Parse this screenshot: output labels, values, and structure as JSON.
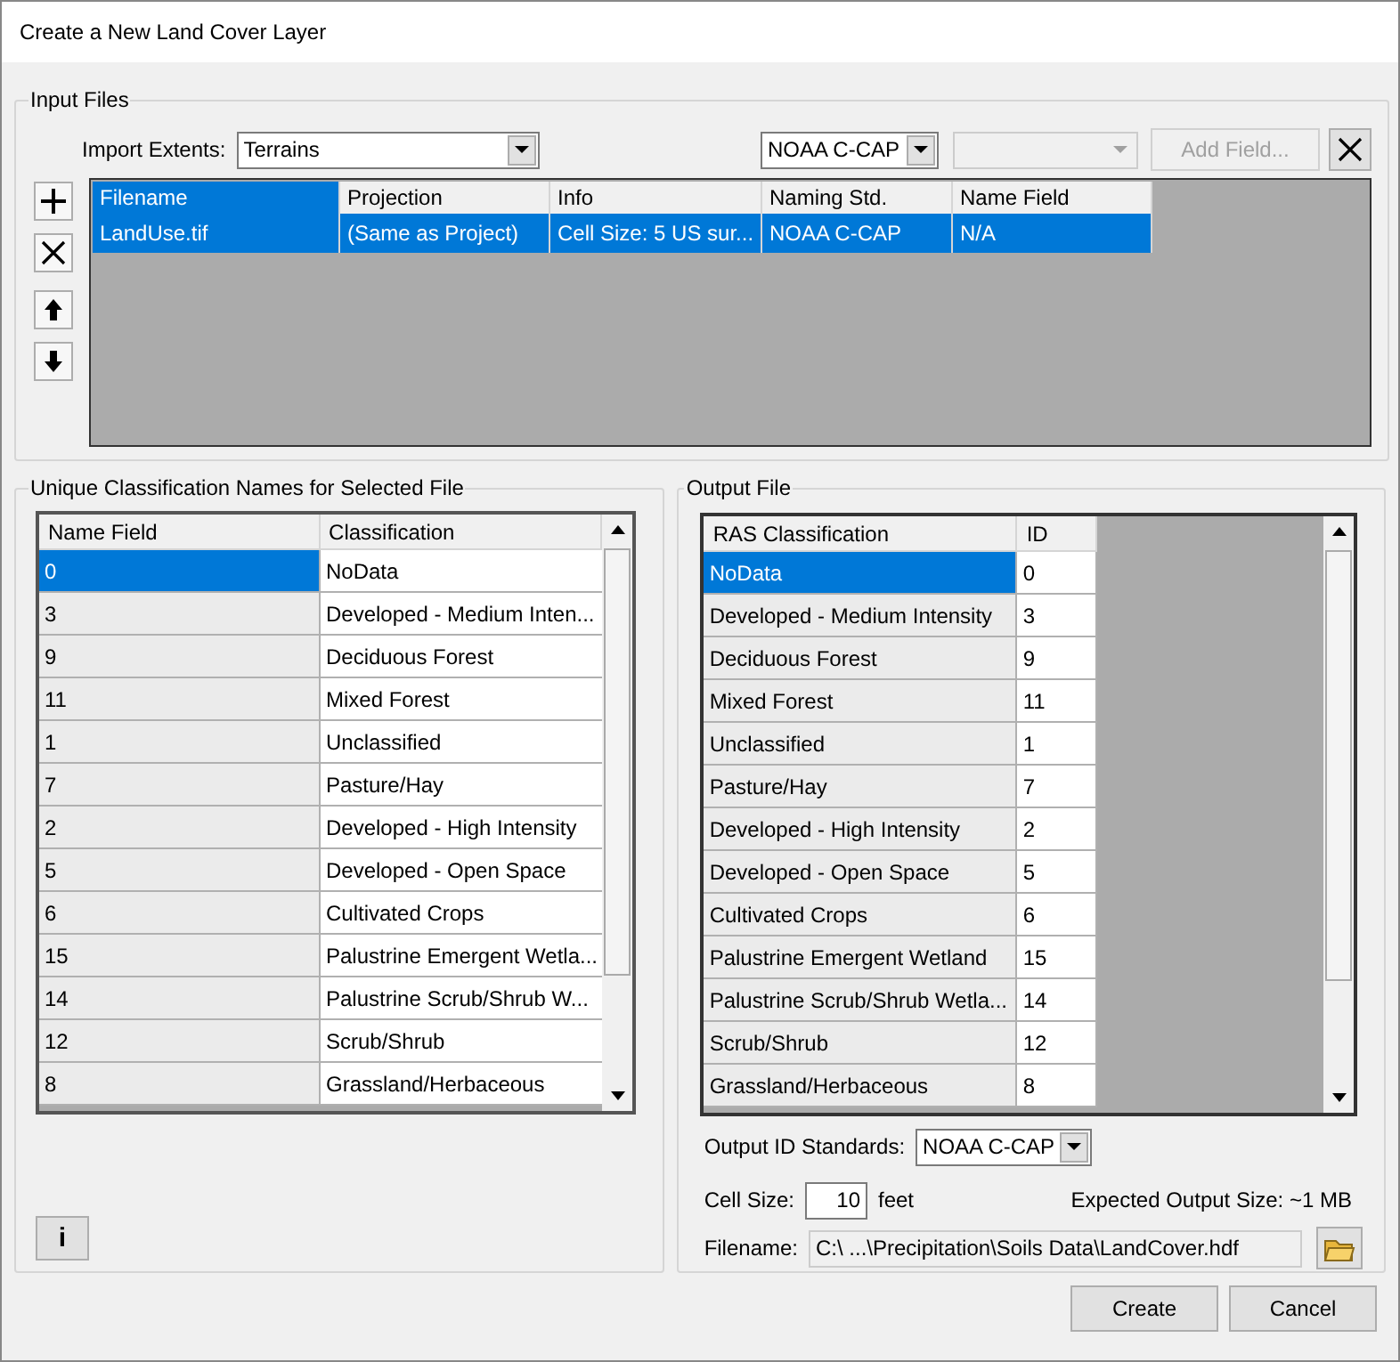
{
  "window": {
    "title": "Create a New Land Cover Layer"
  },
  "input_files": {
    "title": "Input Files",
    "import_extents_label": "Import Extents:",
    "import_extents_value": "Terrains",
    "naming_dropdown": "NOAA C-CAP",
    "add_field_button": {
      "label": "Add Field...",
      "disabled": true
    },
    "columns": [
      "Filename",
      "Projection",
      "Info",
      "Naming Std.",
      "Name Field"
    ],
    "rows": [
      {
        "cells": [
          "LandUse.tif",
          "(Same as Project)",
          "Cell Size: 5 US sur...",
          "NOAA C-CAP",
          "N/A"
        ],
        "selected": true
      }
    ]
  },
  "classification": {
    "title": "Unique Classification Names for Selected File",
    "columns": [
      "Name Field",
      "Classification"
    ],
    "rows": [
      {
        "cells": [
          "0",
          "NoData"
        ],
        "selected": true
      },
      {
        "cells": [
          "3",
          "Developed - Medium Inten..."
        ],
        "selected": false
      },
      {
        "cells": [
          "9",
          "Deciduous Forest"
        ],
        "selected": false
      },
      {
        "cells": [
          "11",
          "Mixed Forest"
        ],
        "selected": false
      },
      {
        "cells": [
          "1",
          "Unclassified"
        ],
        "selected": false
      },
      {
        "cells": [
          "7",
          "Pasture/Hay"
        ],
        "selected": false
      },
      {
        "cells": [
          "2",
          "Developed - High Intensity"
        ],
        "selected": false
      },
      {
        "cells": [
          "5",
          "Developed - Open Space"
        ],
        "selected": false
      },
      {
        "cells": [
          "6",
          "Cultivated Crops"
        ],
        "selected": false
      },
      {
        "cells": [
          "15",
          "Palustrine Emergent Wetla..."
        ],
        "selected": false
      },
      {
        "cells": [
          "14",
          "Palustrine Scrub/Shrub W..."
        ],
        "selected": false
      },
      {
        "cells": [
          "12",
          "Scrub/Shrub"
        ],
        "selected": false
      },
      {
        "cells": [
          "8",
          "Grassland/Herbaceous"
        ],
        "selected": false
      }
    ]
  },
  "output_file": {
    "title": "Output File",
    "columns": [
      "RAS Classification",
      "ID"
    ],
    "rows": [
      {
        "cells": [
          "NoData",
          "0"
        ],
        "selected": true
      },
      {
        "cells": [
          "Developed - Medium Intensity",
          "3"
        ],
        "selected": false
      },
      {
        "cells": [
          "Deciduous Forest",
          "9"
        ],
        "selected": false
      },
      {
        "cells": [
          "Mixed Forest",
          "11"
        ],
        "selected": false
      },
      {
        "cells": [
          "Unclassified",
          "1"
        ],
        "selected": false
      },
      {
        "cells": [
          "Pasture/Hay",
          "7"
        ],
        "selected": false
      },
      {
        "cells": [
          "Developed - High Intensity",
          "2"
        ],
        "selected": false
      },
      {
        "cells": [
          "Developed - Open Space",
          "5"
        ],
        "selected": false
      },
      {
        "cells": [
          "Cultivated Crops",
          "6"
        ],
        "selected": false
      },
      {
        "cells": [
          "Palustrine Emergent Wetland",
          "15"
        ],
        "selected": false
      },
      {
        "cells": [
          "Palustrine Scrub/Shrub Wetla...",
          "14"
        ],
        "selected": false
      },
      {
        "cells": [
          "Scrub/Shrub",
          "12"
        ],
        "selected": false
      },
      {
        "cells": [
          "Grassland/Herbaceous",
          "8"
        ],
        "selected": false
      }
    ],
    "output_id_label": "Output ID Standards:",
    "output_id_value": "NOAA C-CAP",
    "cell_size_label": "Cell Size:",
    "cell_size_value": "10",
    "cell_size_unit": "feet",
    "expected_size": "Expected Output Size: ~1 MB",
    "filename_label": "Filename:",
    "filename_value": "C:\\ ...\\Precipitation\\Soils Data\\LandCover.hdf"
  },
  "info_button": "i",
  "buttons": [
    "Create",
    "Cancel"
  ]
}
